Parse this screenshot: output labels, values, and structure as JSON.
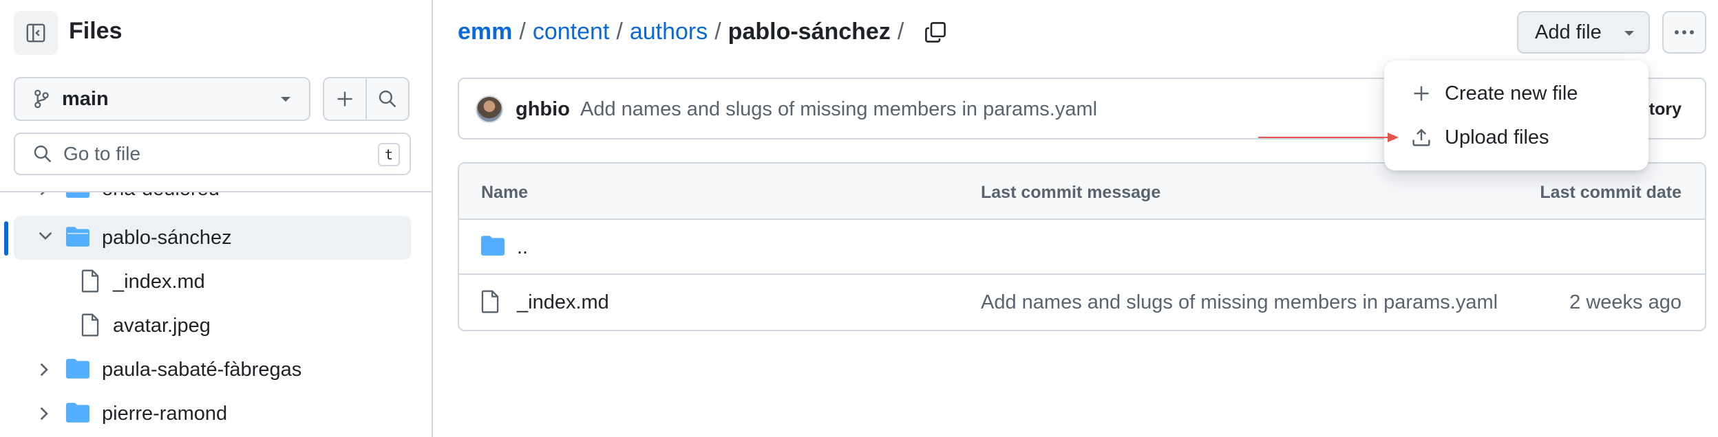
{
  "sidebar": {
    "title": "Files",
    "branch": "main",
    "search": {
      "placeholder": "Go to file",
      "shortcut": "t"
    },
    "tree": [
      {
        "label": "ona-deuloreu",
        "kind": "folder",
        "expanded": false
      },
      {
        "label": "pablo-sánchez",
        "kind": "folder",
        "expanded": true,
        "selected": true
      },
      {
        "label": "_index.md",
        "kind": "file"
      },
      {
        "label": "avatar.jpeg",
        "kind": "file"
      },
      {
        "label": "paula-sabaté-fàbregas",
        "kind": "folder",
        "expanded": false
      },
      {
        "label": "pierre-ramond",
        "kind": "folder",
        "expanded": false
      }
    ]
  },
  "breadcrumb": {
    "items": [
      "emm",
      "content",
      "authors"
    ],
    "current": "pablo-sánchez",
    "separator": "/"
  },
  "toolbar": {
    "add_file_label": "Add file"
  },
  "latest_commit": {
    "author": "ghbio",
    "message": "Add names and slugs of missing members in params.yaml",
    "history_label": "tory"
  },
  "table": {
    "headers": {
      "name": "Name",
      "message": "Last commit message",
      "date": "Last commit date"
    },
    "rows": [
      {
        "name": "..",
        "kind": "parent",
        "message": "",
        "date": ""
      },
      {
        "name": "_index.md",
        "kind": "file",
        "message": "Add names and slugs of missing members in params.yaml",
        "date": "2 weeks ago"
      }
    ]
  },
  "dropdown": {
    "items": [
      {
        "label": "Create new file",
        "icon": "plus-icon"
      },
      {
        "label": "Upload files",
        "icon": "upload-icon"
      }
    ]
  },
  "colors": {
    "link": "#0969da",
    "folder": "#54aeff",
    "annotation_arrow": "#e5534b",
    "border": "#d0d7de"
  }
}
